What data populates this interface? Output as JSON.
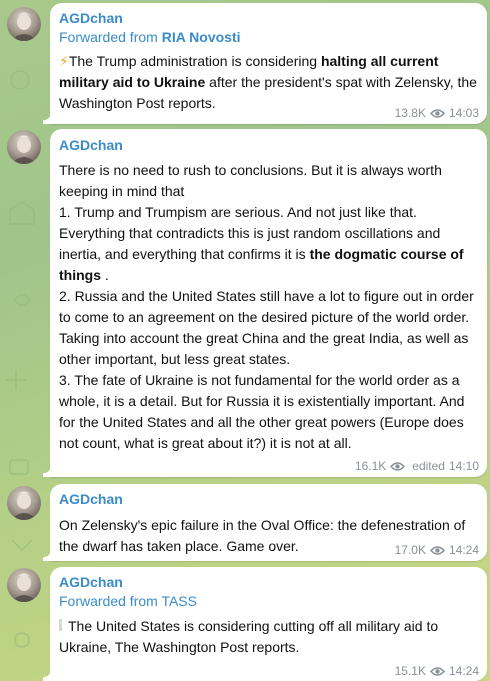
{
  "colors": {
    "accent": "#3a8cc9",
    "meta": "#8a9199",
    "background": "#a8c98a"
  },
  "messages": [
    {
      "sender": "AGDchan",
      "forwarded_prefix": "Forwarded from ",
      "forwarded_source": "RIA Novosti",
      "emoji": "⚡",
      "text_a": "The Trump administration is considering ",
      "text_bold": "halting all current military aid to Ukraine",
      "text_b": " after the president's spat with Zelensky, the Washington Post reports.",
      "views": "13.8K",
      "time": "14:03"
    },
    {
      "sender": "AGDchan",
      "p1": "There is no need to rush to conclusions. But it is always worth keeping in mind that",
      "p2a": "1. Trump and Trumpism are serious. And not just like that. Everything that contradicts this is just random oscillations and inertia, and everything that confirms it is ",
      "p2bold": "the dogmatic course of things",
      "p2b": " .",
      "p3": "2. Russia and the United States still have a lot to figure out in order to come to an agreement on the desired picture of the world order. Taking into account the great China and the great India, as well as other important, but less great states.",
      "p4": "3. The fate of Ukraine is not fundamental for the world order as a whole, it is a detail. But for Russia it is existentially important. And for the United States and all the other great powers (Europe does not count, what is great about it?) it is not at all.",
      "views": "16.1K",
      "edited": "edited",
      "time": "14:10"
    },
    {
      "sender": "AGDchan",
      "text": "On Zelensky's epic failure in the Oval Office: the defenestration of the dwarf has taken place. Game over.",
      "views": "17.0K",
      "time": "14:24"
    },
    {
      "sender": "AGDchan",
      "forwarded_prefix": "Forwarded from ",
      "forwarded_source": "TASS",
      "text": "The United States is considering cutting off all military aid to Ukraine, The Washington Post reports.",
      "views": "15.1K",
      "time": "14:24"
    }
  ]
}
